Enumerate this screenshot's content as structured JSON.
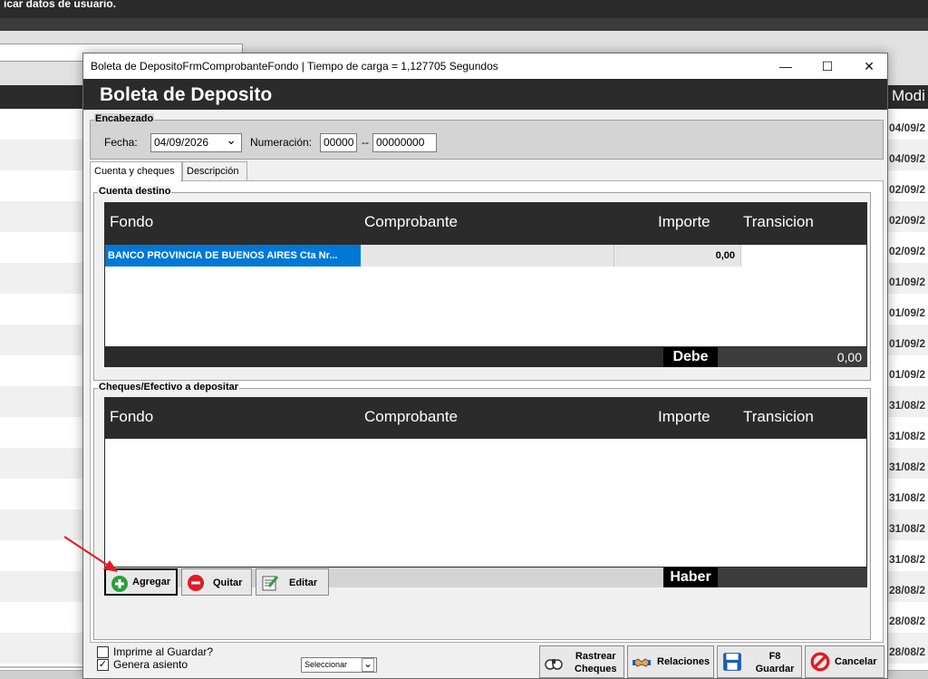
{
  "background": {
    "title_fragment": "icar datos de usuario.",
    "column_header_fragment": "Modi",
    "dates": [
      "04/09/2",
      "04/09/2",
      "02/09/2",
      "02/09/2",
      "02/09/2",
      "01/09/2",
      "01/09/2",
      "01/09/2",
      "01/09/2",
      "31/08/2",
      "31/08/2",
      "31/08/2",
      "31/08/2",
      "31/08/2",
      "31/08/2",
      "28/08/2",
      "28/08/2",
      "28/08/2"
    ]
  },
  "dialog": {
    "window_title": "Boleta de DepositoFrmComprobanteFondo | Tiempo de carga = 1,127705 Segundos",
    "minimize_glyph": "—",
    "maximize_glyph": "☐",
    "close_glyph": "✕",
    "header_title": "Boleta de Deposito",
    "encabezado": {
      "legend": "Encabezado",
      "fecha_label": "Fecha:",
      "fecha_value": "04/09/2026",
      "fecha_dropdown_glyph": "⌄",
      "numeracion_label": "Numeración:",
      "numeracion_prefix": "00000",
      "numeracion_sep": "--",
      "numeracion_number": "00000000"
    },
    "tabs": [
      {
        "label": "Cuenta y cheques",
        "active": true
      },
      {
        "label": "Descripción",
        "active": false
      }
    ],
    "cuenta_destino": {
      "legend": "Cuenta destino",
      "columns": [
        "Fondo",
        "Comprobante",
        "Importe",
        "Transicion"
      ],
      "rows": [
        {
          "fondo": "BANCO PROVINCIA DE BUENOS AIRES  Cta Nr...",
          "comprobante": "",
          "importe": "0,00",
          "transicion": ""
        }
      ],
      "total_label": "Debe",
      "total_value": "0,00"
    },
    "cheques": {
      "legend": "Cheques/Efectivo a depositar",
      "columns": [
        "Fondo",
        "Comprobante",
        "Importe",
        "Transicion"
      ],
      "rows": [],
      "total_label": "Haber",
      "total_value": ""
    },
    "actions": {
      "agregar": "Agregar",
      "quitar": "Quitar",
      "editar": "Editar"
    },
    "options": {
      "imprime_label": "Imprime al Guardar?",
      "imprime_checked": false,
      "genera_label": "Genera asiento",
      "genera_checked": true,
      "check_glyph": "✓",
      "select_value": "Seleccionar",
      "select_glyph": "⌄"
    },
    "footer_buttons": {
      "rastrear_line1": "Rastrear",
      "rastrear_line2": "Cheques",
      "relaciones": "Relaciones",
      "guardar_line1": "F8",
      "guardar_line2": "Guardar",
      "cancelar": "Cancelar"
    }
  },
  "colors": {
    "dark_header": "#2b2b2b",
    "selection_blue": "#0078d7",
    "add_green": "#2e9e3e",
    "remove_red": "#e01b24",
    "save_blue": "#1a5fb4"
  },
  "icons": [
    "plus-circle-icon",
    "minus-circle-icon",
    "edit-note-icon",
    "binoculars-icon",
    "handshake-icon",
    "floppy-disk-icon",
    "cancel-circle-icon",
    "chevron-down-icon",
    "checkbox-icon"
  ]
}
